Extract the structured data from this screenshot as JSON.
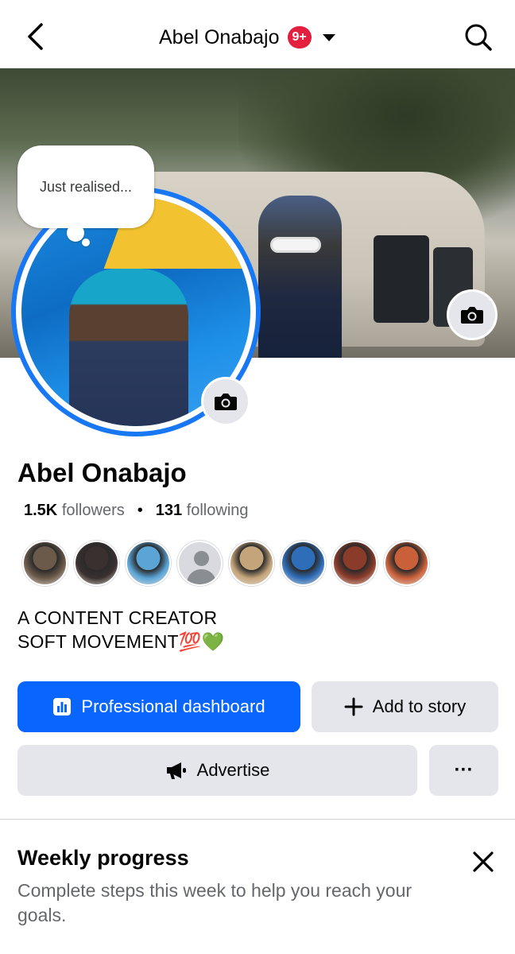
{
  "header": {
    "title": "Abel Onabajo",
    "notification_badge": "9+",
    "icons": [
      "back-arrow-icon",
      "chevron-down-icon",
      "search-icon"
    ]
  },
  "cover": {
    "camera_icon": "camera-icon"
  },
  "note_bubble": {
    "text": "Just realised..."
  },
  "profile": {
    "name": "Abel Onabajo",
    "followers_count": "1.5K",
    "followers_label": "followers",
    "separator": "•",
    "following_count": "131",
    "following_label": "following",
    "bio_line1": "A CONTENT CREATOR",
    "bio_line2": "SOFT MOVEMENT💯💚"
  },
  "friends_preview": [
    {
      "color": "#6b5a4a"
    },
    {
      "color": "#3b3030"
    },
    {
      "color": "#5aa4d6"
    },
    {
      "color": "#d8dadf",
      "generic": true
    },
    {
      "color": "#c4a47a"
    },
    {
      "color": "#2e6db8"
    },
    {
      "color": "#8b3b2a"
    },
    {
      "color": "#c9603a"
    }
  ],
  "actions": {
    "professional_dashboard": "Professional dashboard",
    "add_to_story": "Add to story",
    "advertise": "Advertise",
    "more": "···"
  },
  "weekly_progress": {
    "title": "Weekly progress",
    "description": "Complete steps this week to help you reach your goals."
  },
  "colors": {
    "primary_blue": "#0866ff",
    "badge_red": "#e41e3f",
    "secondary_gray": "#e4e6eb"
  }
}
